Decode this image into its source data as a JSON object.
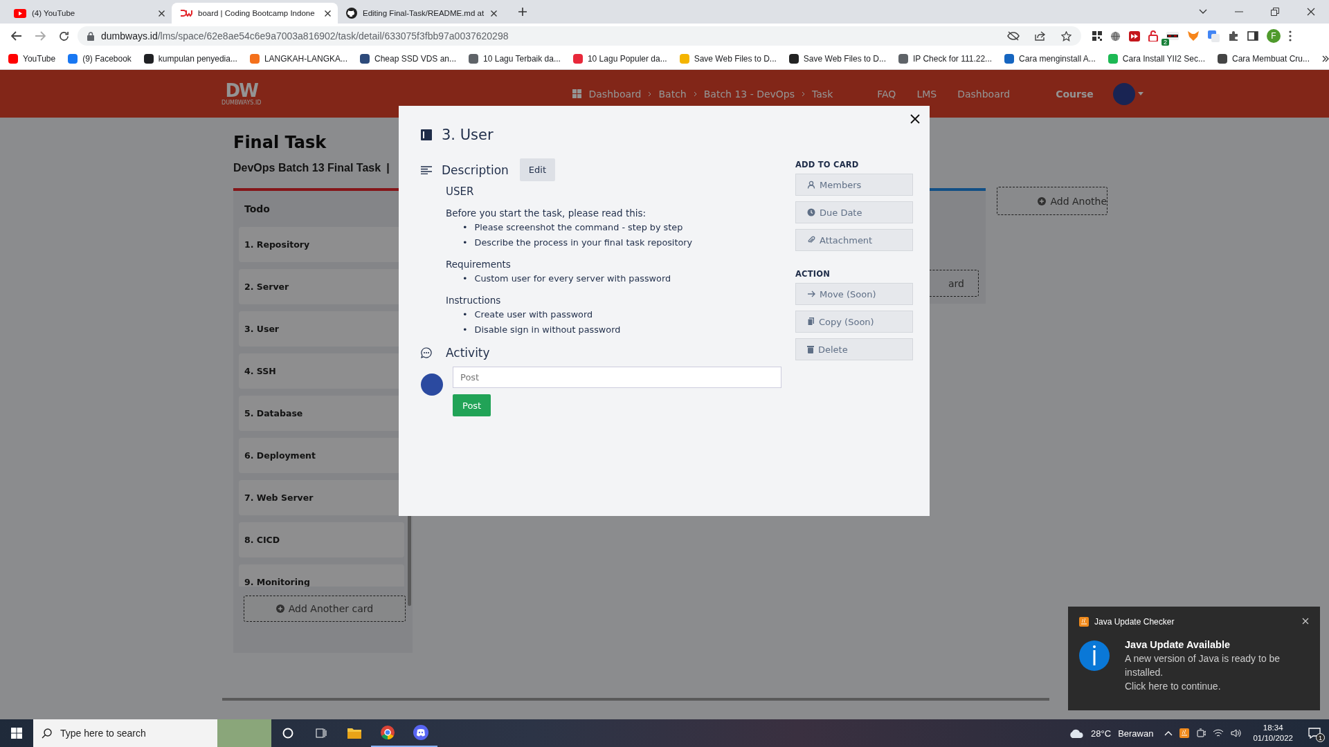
{
  "browser": {
    "tabs": [
      {
        "title": "(4) YouTube",
        "kind": "youtube",
        "selected": false
      },
      {
        "title": "board | Coding Bootcamp Indone",
        "kind": "dw",
        "selected": true
      },
      {
        "title": "Editing Final-Task/README.md at",
        "kind": "github",
        "selected": false
      }
    ],
    "url_host": "dumbways.id",
    "url_path": "/lms/space/62e8ae54c6e9a7003a816902/task/detail/633075f3fbb97a0037620298",
    "bookmarks": [
      {
        "label": "YouTube",
        "color": "#ff0000"
      },
      {
        "label": "(9) Facebook",
        "color": "#1877f2"
      },
      {
        "label": "kumpulan penyedia...",
        "color": "#202124"
      },
      {
        "label": "LANGKAH-LANGKA...",
        "color": "#f4701b"
      },
      {
        "label": "Cheap SSD VDS an...",
        "color": "#2d4a7a"
      },
      {
        "label": "10 Lagu Terbaik da...",
        "color": "#5f6368"
      },
      {
        "label": "10 Lagu Populer da...",
        "color": "#e8283a"
      },
      {
        "label": "Save Web Files to D...",
        "color": "#f4b400"
      },
      {
        "label": "Save Web Files to D...",
        "color": "#222222"
      },
      {
        "label": "IP Check for 111.22...",
        "color": "#5f6368"
      },
      {
        "label": "Cara menginstall A...",
        "color": "#1565c0"
      },
      {
        "label": "Cara Install YII2 Sec...",
        "color": "#1db954"
      },
      {
        "label": "Cara Membuat Cru...",
        "color": "#444444"
      }
    ],
    "profile_initial": "F",
    "extension_badge": "2"
  },
  "site": {
    "logo": "DW",
    "logo_caption": "DUMBWAYS.ID",
    "breadcrumbs": [
      "Dashboard",
      "Batch",
      "Batch 13 - DevOps",
      "Task"
    ],
    "links": [
      "FAQ",
      "LMS",
      "Dashboard"
    ],
    "course": "Course"
  },
  "board": {
    "title": "Final Task",
    "subtitle": "DevOps Batch 13 Final Task",
    "separator": "|",
    "todo": {
      "title": "Todo",
      "cards": [
        "1. Repository",
        "2. Server",
        "3. User",
        "4. SSH",
        "5. Database",
        "6. Deployment",
        "7. Web Server",
        "8. CICD",
        "9. Monitoring"
      ],
      "add_button": "Add Another card"
    },
    "column_2": {
      "button_text": "ard"
    },
    "add_list": "Add Anothe"
  },
  "modal": {
    "title": "3. User",
    "bullet": "•",
    "description_heading": "Description",
    "edit_button": "Edit",
    "content_heading": "USER",
    "sections": [
      {
        "heading": "Before you start the task, please read this:",
        "items": [
          "Please screenshot the command - step by step",
          "Describe the process in your final task repository"
        ]
      },
      {
        "heading": "Requirements",
        "items": [
          "Custom user for every server with password"
        ]
      },
      {
        "heading": "Instructions",
        "items": [
          "Create user with password",
          "Disable sign in without password"
        ]
      }
    ],
    "side_groups": [
      {
        "heading": "ADD TO CARD",
        "buttons": [
          {
            "label": "Members",
            "kind": "person"
          },
          {
            "label": "Due Date",
            "kind": "clock"
          },
          {
            "label": "Attachment",
            "kind": "paperclip"
          }
        ]
      },
      {
        "heading": "ACTION",
        "buttons": [
          {
            "label": "Move (Soon)",
            "kind": "arrow"
          },
          {
            "label": "Copy (Soon)",
            "kind": "copy"
          },
          {
            "label": "Delete",
            "kind": "trash"
          }
        ]
      }
    ],
    "activity_heading": "Activity",
    "comment_placeholder": "Post",
    "post_button": "Post"
  },
  "notification": {
    "app": "Java Update Checker",
    "title": "Java Update Available",
    "body": "A new version of Java is ready to be installed.",
    "action": "Click here to continue."
  },
  "taskbar": {
    "search_placeholder": "Type here to search",
    "temperature": "28°C",
    "weather": "Berawan",
    "time": "18:34",
    "date": "01/10/2022",
    "notification_count": "1"
  }
}
